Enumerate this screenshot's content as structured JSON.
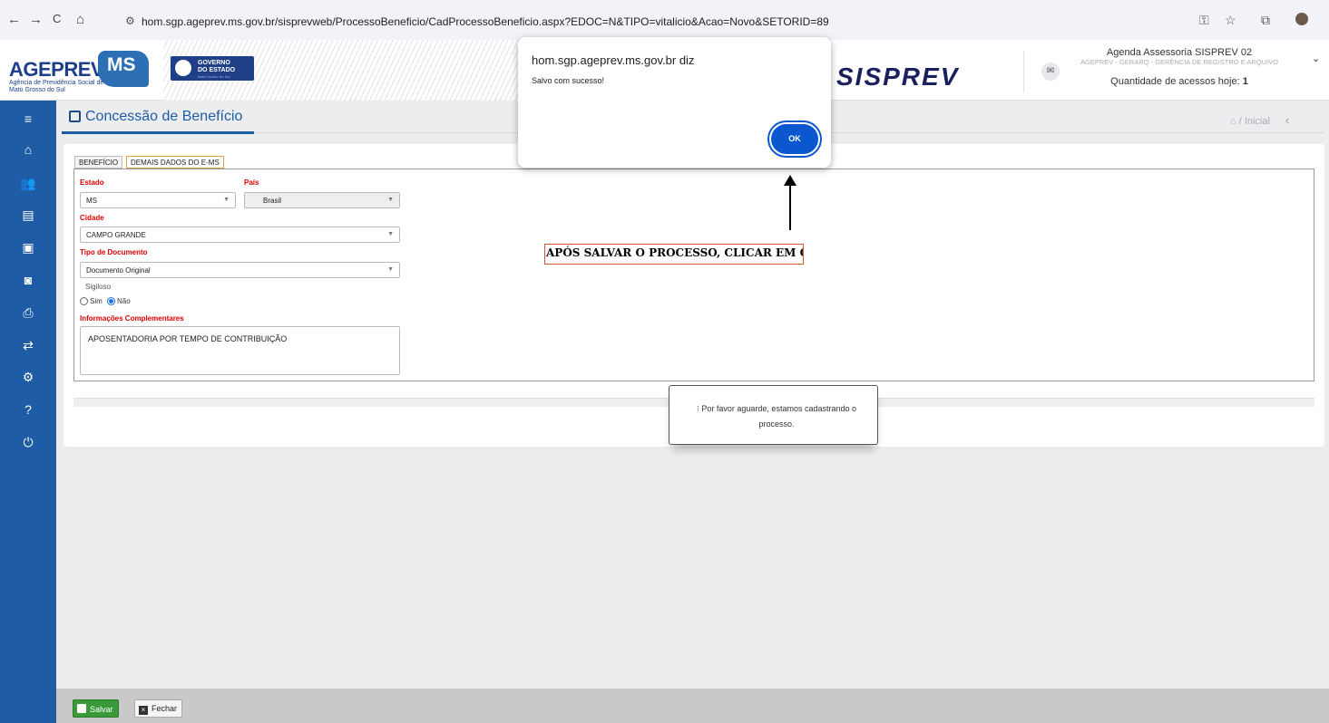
{
  "browser": {
    "back": "←",
    "forward": "→",
    "reload": "C",
    "home": "⌂",
    "url": "hom.sgp.ageprev.ms.gov.br/sisprevweb/ProcessoBeneficio/CadProcessoBeneficio.aspx?EDOC=N&TIPO=vitalicio&Acao=Novo&SETORID=89"
  },
  "header": {
    "logo_main": "AGEPREV",
    "logo_ms": "MS",
    "logo_sub": "Agência de Previdência Social de Mato Grosso do Sul",
    "gov_line1": "GOVERNO",
    "gov_line2": "DO ESTADO",
    "gov_line3": "Mato Grosso do Sul",
    "system_name": "SISPREV",
    "user_name": "Agenda Assessoria SISPREV 02",
    "user_dept": "AGEPREV - GERARQ - GERÊNCIA DE REGISTRO E ARQUIVO",
    "access_label": "Quantidade de acessos hoje:",
    "access_count": "1"
  },
  "page": {
    "title": "Concessão de Benefício",
    "breadcrumb": "/ Inicial"
  },
  "tabs": [
    {
      "label": "BENEFÍCIO"
    },
    {
      "label": "DEMAIS DADOS DO E-MS"
    }
  ],
  "form": {
    "estado_label": "Estado",
    "estado_value": "MS",
    "pais_label": "País",
    "pais_value": "Brasil",
    "cidade_label": "Cidade",
    "cidade_value": "CAMPO GRANDE",
    "tipo_doc_label": "Tipo de Documento",
    "tipo_doc_value": "Documento Original",
    "sigiloso_label": "Sigiloso",
    "sigiloso_sim": "Sim",
    "sigiloso_nao": "Não",
    "info_label": "Informações Complementares",
    "info_value": "APOSENTADORIA POR TEMPO DE CONTRIBUIÇÃO"
  },
  "annotation": "APÓS SALVAR O PROCESSO, CLICAR EM OK",
  "dialog": {
    "title": "hom.sgp.ageprev.ms.gov.br diz",
    "message": "Salvo com sucesso!",
    "ok": "OK"
  },
  "wait": {
    "message": "Por favor aguarde, estamos cadastrando o processo."
  },
  "footer": {
    "save": "Salvar",
    "close": "Fechar"
  },
  "colors": {
    "primary": "#1f5ca6",
    "required": "#dd0000",
    "save_green": "#3a9a3a",
    "dialog_blue": "#0b57d0"
  }
}
